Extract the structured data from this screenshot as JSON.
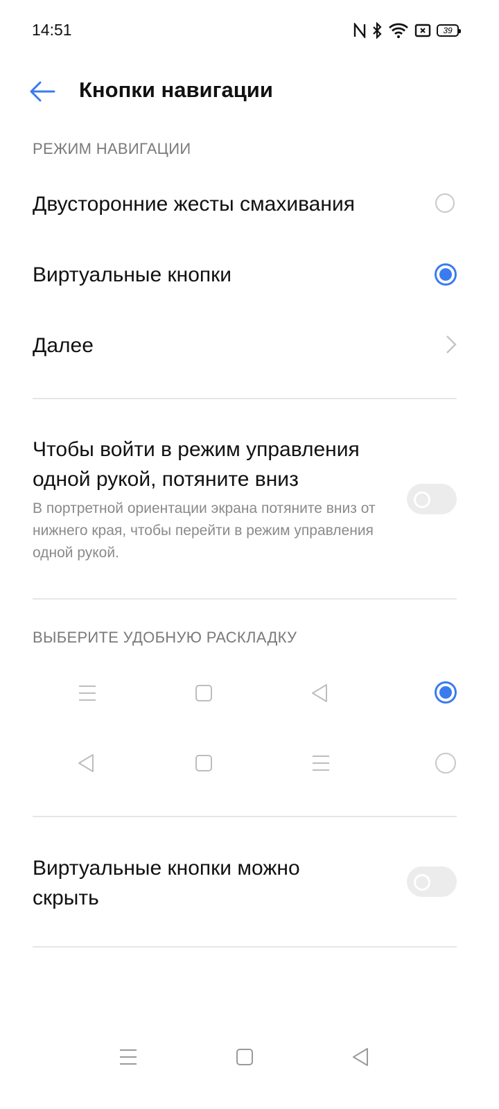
{
  "status_bar": {
    "time": "14:51",
    "battery": "39",
    "icons": [
      "nfc-icon",
      "bluetooth-icon",
      "wifi-icon",
      "sim-icon",
      "battery-icon"
    ]
  },
  "header": {
    "title": "Кнопки навигации",
    "back_icon": "back-arrow-icon"
  },
  "nav_mode": {
    "section_title": "РЕЖИМ НАВИГАЦИИ",
    "options": [
      {
        "label": "Двусторонние жесты смахивания",
        "selected": false
      },
      {
        "label": "Виртуальные кнопки",
        "selected": true
      }
    ],
    "more_label": "Далее"
  },
  "one_hand": {
    "title": "Чтобы войти в режим управления одной рукой, потяните вниз",
    "description": "В портретной ориентации экрана потяните вниз от нижнего края, чтобы перейти в режим управления одной рукой.",
    "enabled": false
  },
  "layout": {
    "section_title": "ВЫБЕРИТЕ УДОБНУЮ РАСКЛАДКУ",
    "options": [
      {
        "buttons": [
          "menu-icon",
          "home-square-icon",
          "back-triangle-icon"
        ],
        "selected": true
      },
      {
        "buttons": [
          "back-triangle-icon",
          "home-square-icon",
          "menu-icon"
        ],
        "selected": false
      }
    ]
  },
  "hide_buttons": {
    "title": "Виртуальные кнопки можно скрыть",
    "enabled": false
  },
  "colors": {
    "accent": "#3a7bef",
    "secondary_text": "#8a8a8a",
    "divider": "#e6e6e6"
  }
}
